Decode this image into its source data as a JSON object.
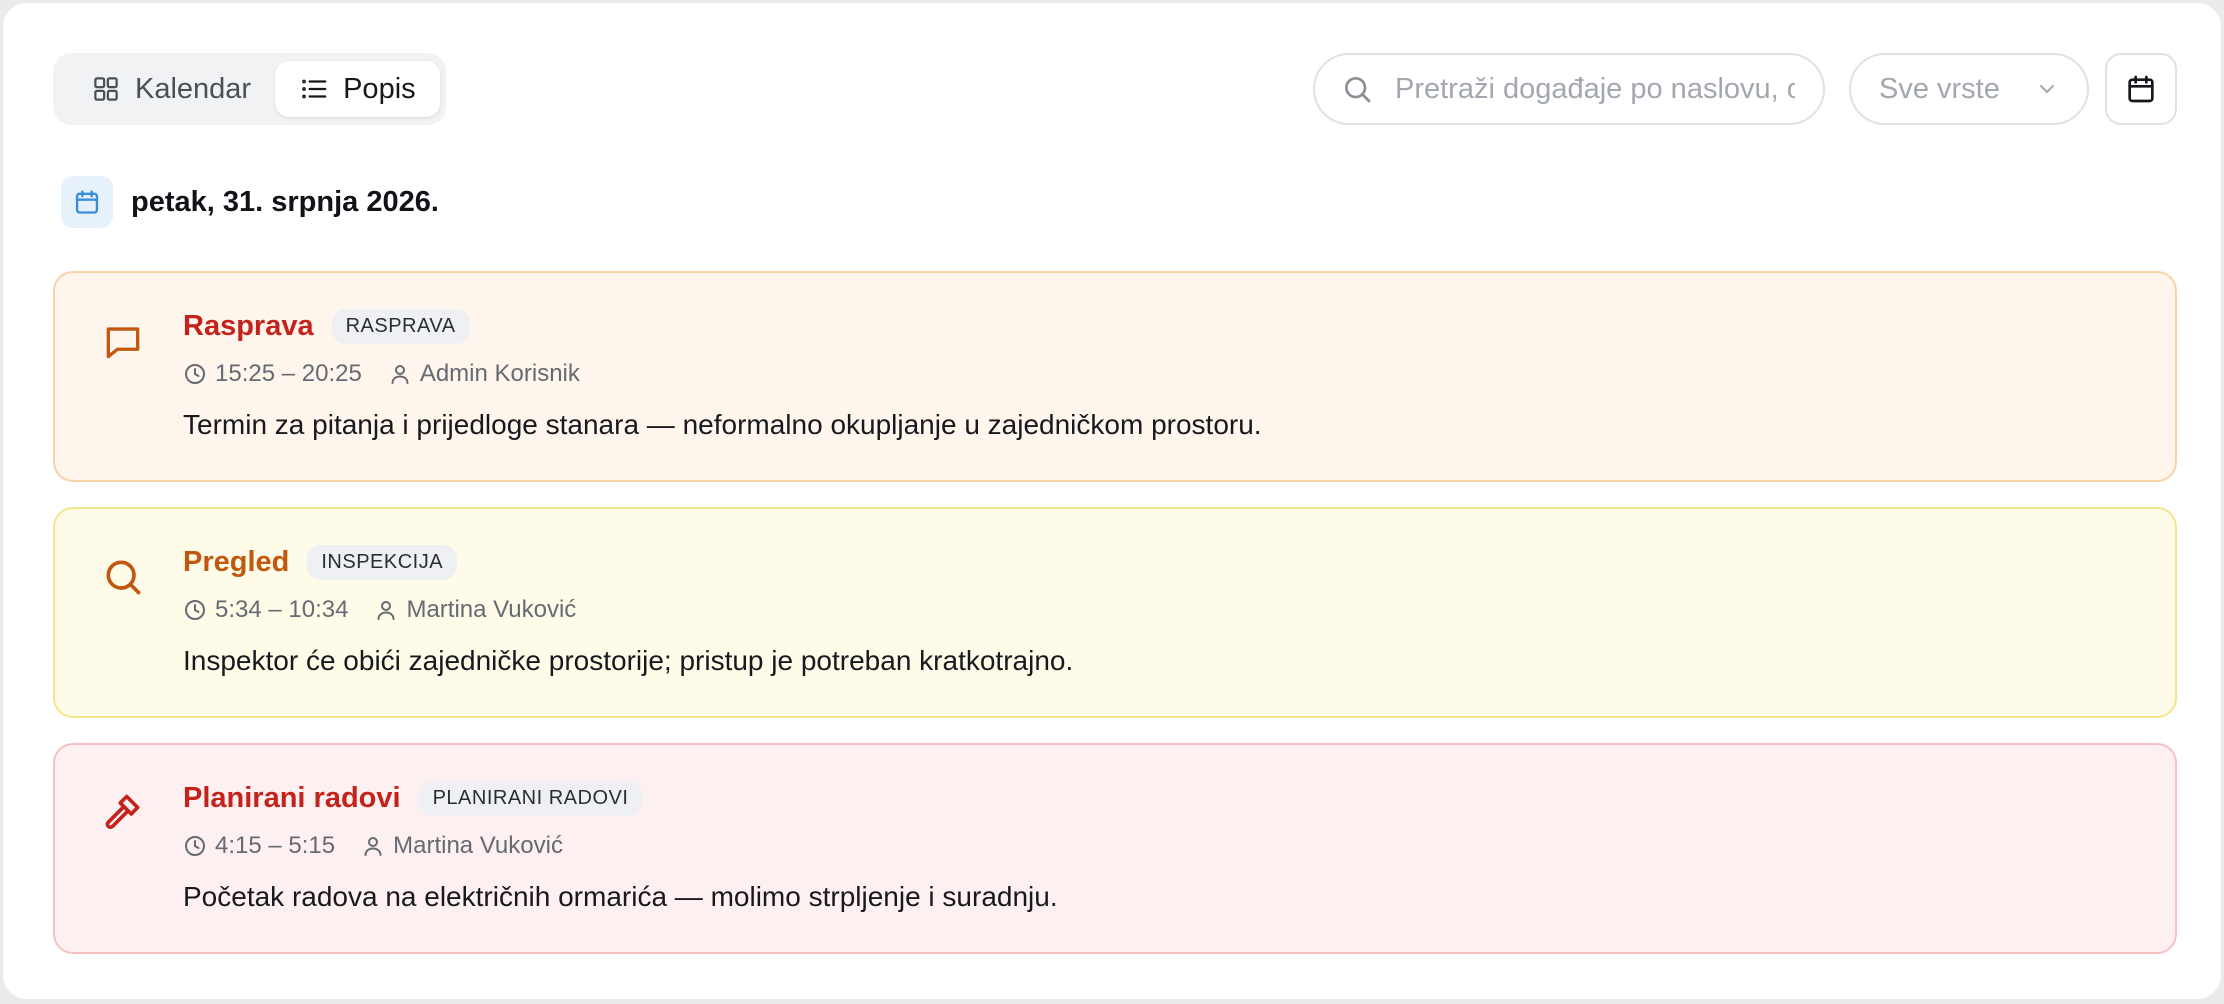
{
  "view_toggle": {
    "calendar_label": "Kalendar",
    "list_label": "Popis",
    "active": "list"
  },
  "search": {
    "placeholder": "Pretraži događaje po naslovu, opisu"
  },
  "type_filter": {
    "selected": "Sve vrste"
  },
  "date_heading": "petak, 31. srpnja 2026.",
  "colors": {
    "discussion": {
      "bg": "#fef5ec",
      "border": "#f8d3a8",
      "title": "#c4231c",
      "icon": "#c2570f"
    },
    "inspection": {
      "bg": "#fefbe9",
      "border": "#f6e58f",
      "title": "#c2570f",
      "icon": "#c2570f"
    },
    "works": {
      "bg": "#fdf0f1",
      "border": "#f6c0c4",
      "title": "#c4231c",
      "icon": "#c4231c"
    }
  },
  "events": [
    {
      "icon": "chat-bubble-icon",
      "title": "Rasprava",
      "badge": "RASPRAVA",
      "time": "15:25 – 20:25",
      "person": "Admin Korisnik",
      "description": "Termin za pitanja i prijedloge stanara — neformalno okupljanje u zajedničkom prostoru."
    },
    {
      "icon": "magnifier-icon",
      "title": "Pregled",
      "badge": "INSPEKCIJA",
      "time": "5:34 – 10:34",
      "person": "Martina Vuković",
      "description": "Inspektor će obići zajedničke prostorije; pristup je potreban kratkotrajno."
    },
    {
      "icon": "hammer-icon",
      "title": "Planirani radovi",
      "badge": "PLANIRANI RADOVI",
      "time": "4:15 – 5:15",
      "person": "Martina Vuković",
      "description": "Početak radova na električnih ormarića — molimo strpljenje i suradnju."
    }
  ]
}
